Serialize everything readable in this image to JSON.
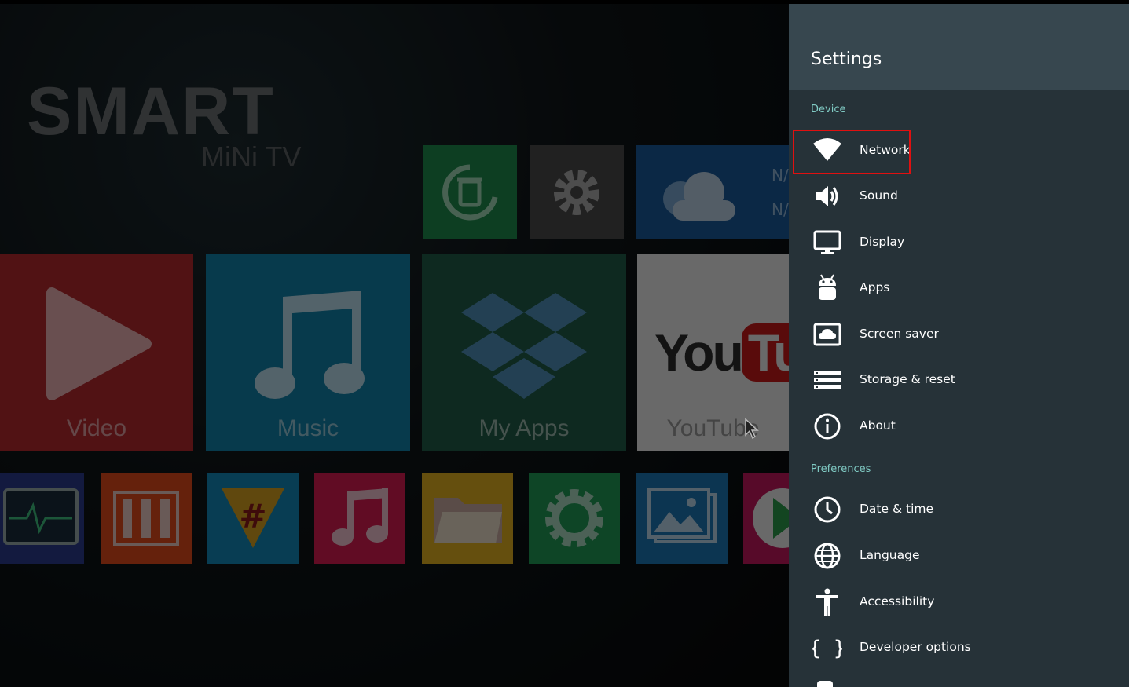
{
  "background": {
    "logo": {
      "main": "SMART",
      "sub": "MiNi TV"
    },
    "tiles": [
      {
        "key": "video",
        "label": "Video",
        "color": "#b3282e"
      },
      {
        "key": "music",
        "label": "Music",
        "color": "#1180a8"
      },
      {
        "key": "myapps",
        "label": "My Apps",
        "color": "#1f5c48"
      },
      {
        "key": "youtube",
        "label": "YouTube",
        "color": "#e8e8e8"
      }
    ],
    "top_tiles": [
      {
        "key": "cleaner",
        "color": "#1e8a4d"
      },
      {
        "key": "settings",
        "color": "#4a4a4a"
      },
      {
        "key": "weather",
        "color": "#1a5a9a",
        "text_top": "N/",
        "text_bottom": "N/"
      }
    ],
    "app_row": [
      {
        "key": "monitor",
        "color": "#2b3b8c"
      },
      {
        "key": "equalizer",
        "color": "#e04a1c"
      },
      {
        "key": "hashtag",
        "color": "#1387b8"
      },
      {
        "key": "music-note",
        "color": "#d81b50"
      },
      {
        "key": "folder",
        "color": "#e0b020"
      },
      {
        "key": "gear",
        "color": "#1f9a56"
      },
      {
        "key": "gallery",
        "color": "#1c77b3"
      },
      {
        "key": "play-store",
        "color": "#c2185b"
      }
    ]
  },
  "settings": {
    "title": "Settings",
    "sections": {
      "device": "Device",
      "preferences": "Preferences"
    },
    "device_items": [
      {
        "label": "Network",
        "icon": "wifi-icon"
      },
      {
        "label": "Sound",
        "icon": "speaker-icon"
      },
      {
        "label": "Display",
        "icon": "monitor-icon"
      },
      {
        "label": "Apps",
        "icon": "android-icon"
      },
      {
        "label": "Screen saver",
        "icon": "screensaver-icon"
      },
      {
        "label": "Storage & reset",
        "icon": "storage-icon"
      },
      {
        "label": "About",
        "icon": "info-icon"
      }
    ],
    "preference_items": [
      {
        "label": "Date & time",
        "icon": "clock-icon"
      },
      {
        "label": "Language",
        "icon": "globe-icon"
      },
      {
        "label": "Accessibility",
        "icon": "accessibility-icon"
      },
      {
        "label": "Developer options",
        "icon": "braces-icon"
      }
    ],
    "selected": "Network",
    "colors": {
      "panel": "#263238",
      "header": "#37474f",
      "accent": "#80cbc4",
      "highlight": "#e01010"
    }
  }
}
